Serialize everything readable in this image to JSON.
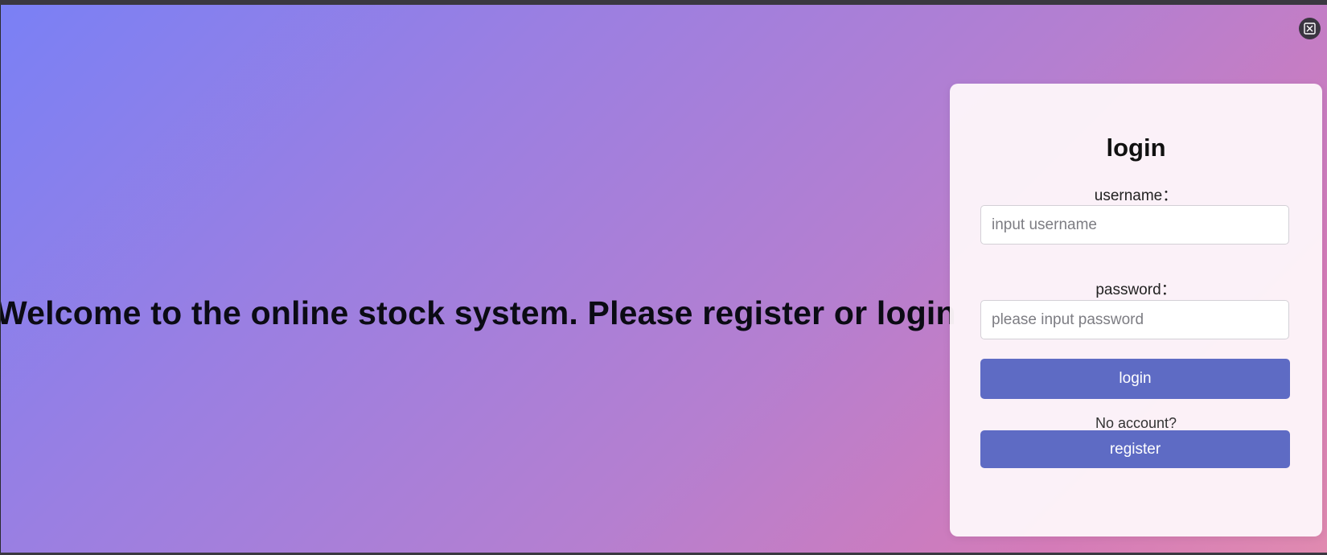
{
  "welcome_text": "Welcome to the online stock system. Please register or login",
  "exit_fullscreen_icon": "exit-fullscreen-icon",
  "login_form": {
    "title": "login",
    "username_label": "username：",
    "username_placeholder": "input username",
    "username_value": "",
    "password_label": "password：",
    "password_placeholder": "please input password",
    "password_value": "",
    "login_button": "login",
    "no_account_text": "No account?",
    "register_button": "register"
  },
  "colors": {
    "gradient_start": "#7a80f5",
    "gradient_end": "#e08ab0",
    "button": "#5e6bc4",
    "card": "#fdf6fa"
  }
}
